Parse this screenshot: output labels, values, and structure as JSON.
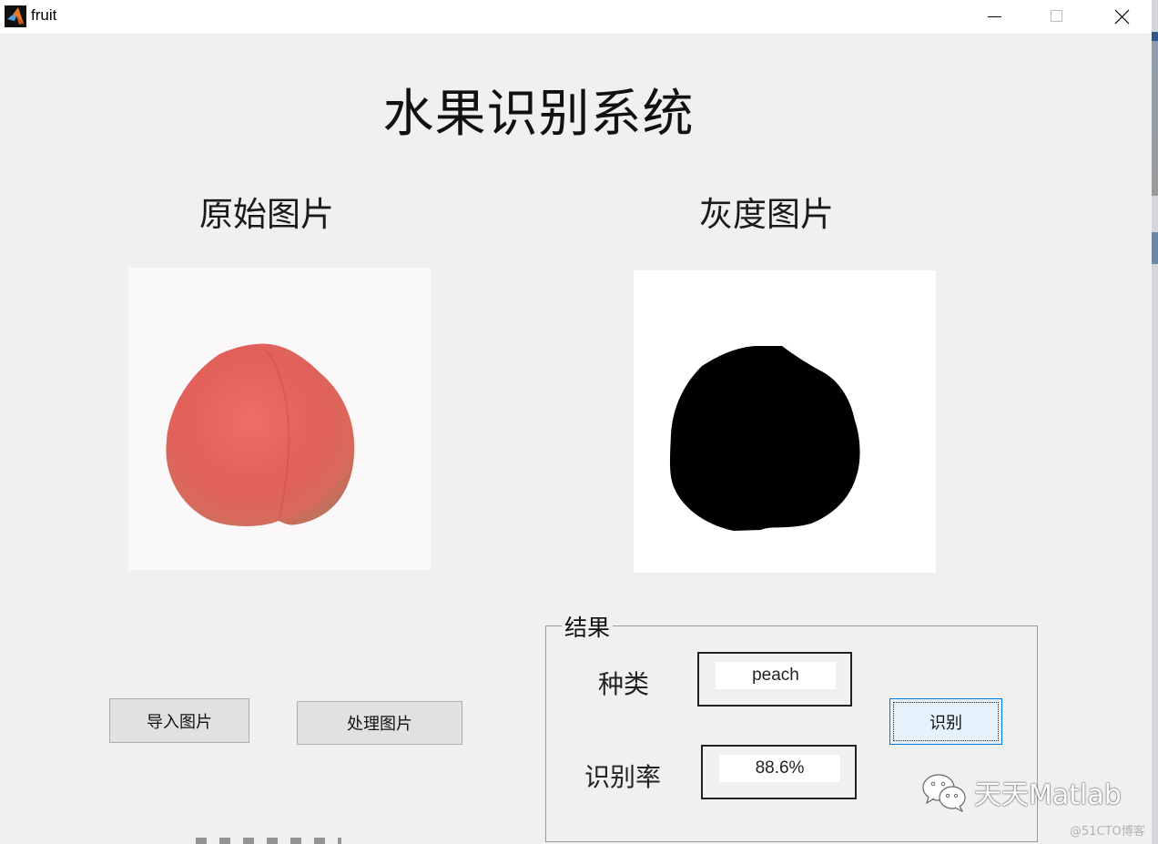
{
  "window": {
    "title": "fruit",
    "icon": "matlab-icon",
    "controls": [
      "minimize",
      "maximize",
      "close"
    ]
  },
  "main_title": "水果识别系统",
  "panels": {
    "original": {
      "title": "原始图片",
      "image": "peach-photo"
    },
    "grayscale": {
      "title": "灰度图片",
      "image": "peach-binary-mask"
    }
  },
  "buttons": {
    "import": "导入图片",
    "process": "处理图片",
    "recognize": "识别"
  },
  "result_group": {
    "title": "结果",
    "kind_label": "种类",
    "kind_value": "peach",
    "rate_label": "识别率",
    "rate_value": "88.6%"
  },
  "watermark": {
    "text": "天天Matlab",
    "credit": "@51CTO博客"
  },
  "colors": {
    "background": "#f0f0f0",
    "focus_button_fill": "#e5f1fb",
    "focus_button_border": "#0078d7",
    "peach": "#e4625e"
  }
}
